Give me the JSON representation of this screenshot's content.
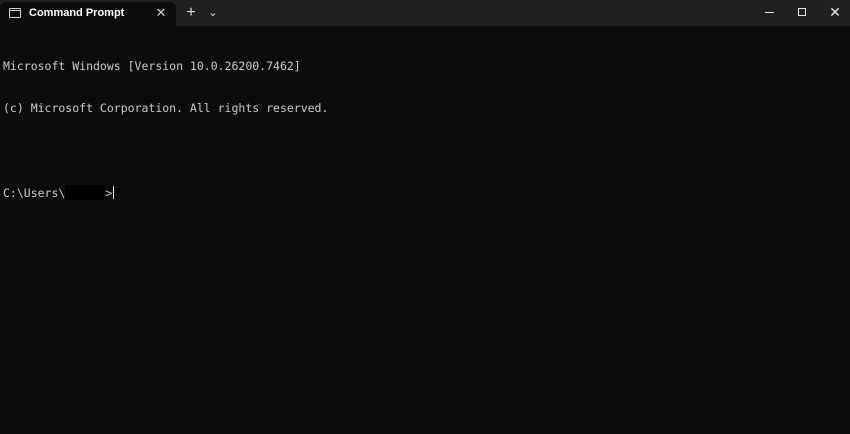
{
  "window": {
    "tab_title": "Command Prompt",
    "tab_close_glyph": "✕",
    "new_tab_glyph": "+",
    "dropdown_glyph": "⌄",
    "close_glyph": "✕"
  },
  "terminal": {
    "lines": [
      "Microsoft Windows [Version 10.0.26200.7462]",
      "(c) Microsoft Corporation. All rights reserved."
    ],
    "prompt_prefix": "C:\\Users\\",
    "prompt_suffix": ">"
  },
  "colors": {
    "titlebar_bg": "#202020",
    "terminal_bg": "#0c0c0c",
    "terminal_text": "#cccccc"
  },
  "icons": {
    "tab_icon": "terminal-icon",
    "minimize": "minimize-icon",
    "maximize": "maximize-icon",
    "close": "close-icon"
  }
}
